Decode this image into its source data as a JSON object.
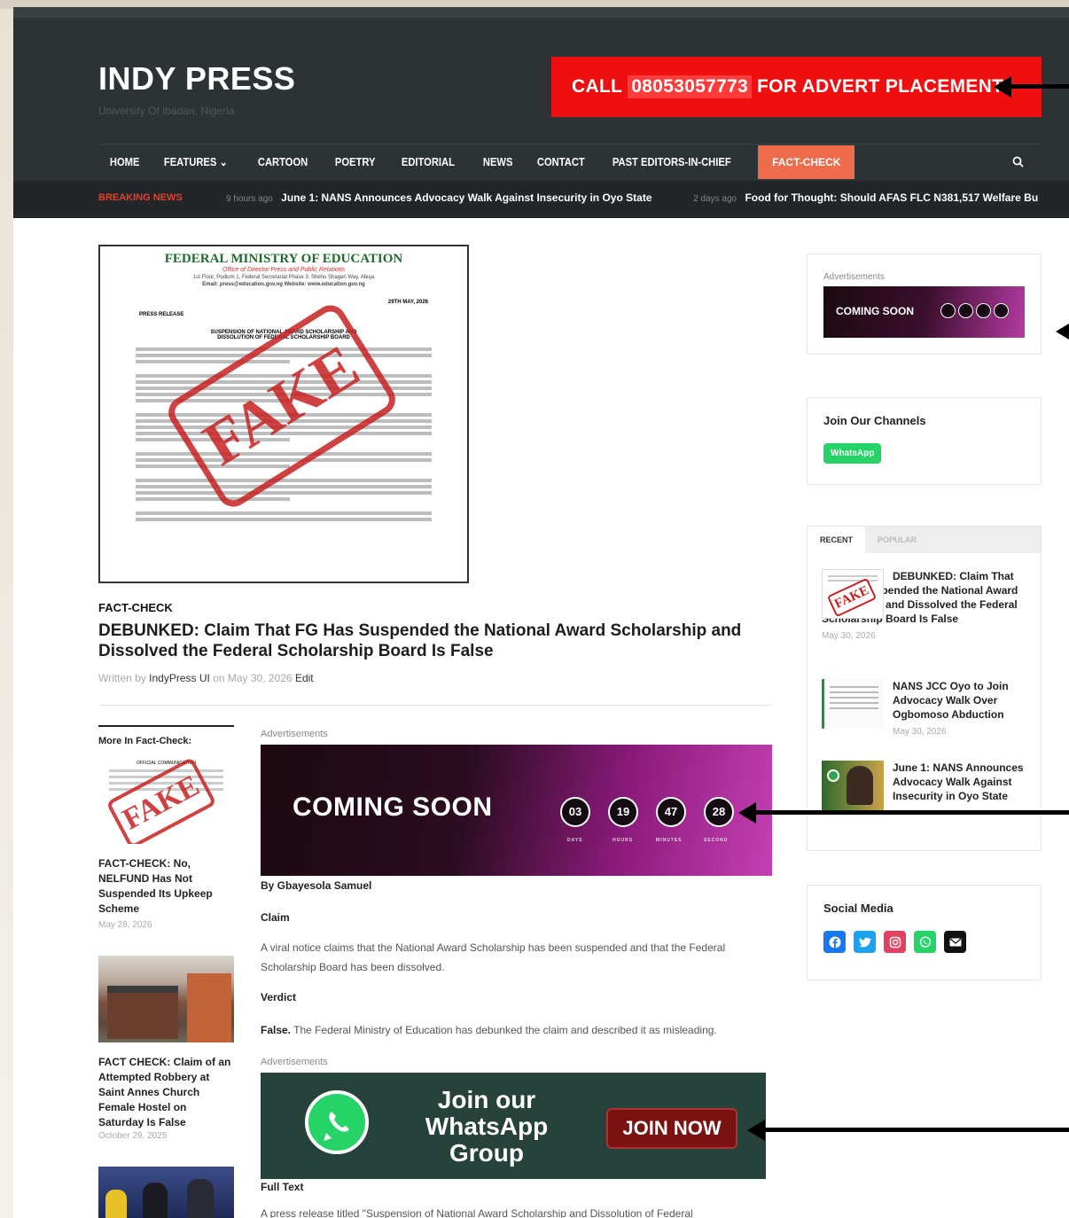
{
  "site": {
    "logo": "INDY PRESS",
    "tagline": "University Of Ibadan, Nigeria"
  },
  "advert": {
    "prefix": "CALL",
    "phone": "08053057773",
    "suffix": "FOR ADVERT PLACEMENT"
  },
  "nav": {
    "items": [
      "HOME",
      "FEATURES",
      "CARTOON",
      "POETRY",
      "EDITORIAL",
      "NEWS",
      "CONTACT",
      "PAST EDITORS-IN-CHIEF",
      "FACT-CHECK"
    ],
    "dropdown_marker": "⌄"
  },
  "breaking": {
    "label": "BREAKING NEWS",
    "items": [
      {
        "ago": "9 hours ago",
        "title": "June 1: NANS Announces Advocacy Walk Against Insecurity in Oyo State"
      },
      {
        "ago": "2 days ago",
        "title": "Food for Thought: Should AFAS FLC N381,517 Welfare Bu"
      }
    ]
  },
  "document": {
    "heading": "FEDERAL MINISTRY OF EDUCATION",
    "subheading": "Office of Director Press and Public Relations",
    "address": "1st Floor, Podium 1, Federal Secretariat Phase 3, Shehu Shagari Way, Abuja",
    "contact": "Email: press@education.gov.ng   Website: www.education.gov.ng",
    "date": "29TH MAY, 2026",
    "label": "PRESS RELEASE",
    "title_1": "SUSPENSION OF NATIONAL AWARD SCHOLARSHIP AND",
    "title_2": "DISSOLUTION OF FEDERAL SCHOLARSHIP BOARD",
    "stamp": "FAKE"
  },
  "article": {
    "category": "FACT-CHECK",
    "title": "DEBUNKED: Claim That FG Has Suspended the National Award Scholarship and Dissolved the Federal Scholarship Board Is False",
    "written_by": "Written by",
    "author": "IndyPress UI",
    "on": "on",
    "date": "May 30, 2026",
    "edit": "Edit",
    "ads_label": "Advertisements",
    "by": "By Gbayesola Samuel",
    "claim_heading": "Claim",
    "claim_text": "A viral notice claims that the National Award Scholarship has been suspended and that the Federal Scholarship Board has been dissolved.",
    "verdict_heading": "Verdict",
    "verdict_lead": "False.",
    "verdict_text": "The Federal Ministry of Education has debunked the claim and described it as misleading.",
    "full_text_heading": "Full Text",
    "full_text_start": "A press release titled \"Suspension of National Award Scholarship and Dissolution of Federal"
  },
  "countdown": {
    "headline": "COMING SOON",
    "values": [
      "03",
      "19",
      "47",
      "28"
    ],
    "labels": [
      "DAYS",
      "HOURS",
      "MINUTES",
      "SECOND"
    ]
  },
  "whatsapp_ad": {
    "line1": "Join our",
    "line2": "WhatsApp",
    "line3": "Group",
    "button": "JOIN NOW"
  },
  "more": {
    "heading": "More In Fact-Check:",
    "items": [
      {
        "title": "FACT-CHECK: No, NELFUND Has Not Suspended Its Upkeep Scheme",
        "date": "May 28, 2026",
        "thumb_text": "OFFICIAL COMMUNICATION"
      },
      {
        "title": "FACT CHECK: Claim of an Attempted Robbery at Saint Annes Church Female Hostel on Saturday Is False",
        "date": "October 29, 2025"
      }
    ]
  },
  "sidebar": {
    "ads_label": "Advertisements",
    "ad_headline": "COMING SOON",
    "channels_title": "Join Our Channels",
    "whatsapp_button": "WhatsApp",
    "tabs": [
      "RECENT",
      "POPULAR"
    ],
    "recent": [
      {
        "title": "DEBUNKED: Claim That FG Has Suspended the National Award Scholarship and Dissolved the Federal Scholarship Board Is False",
        "date": "May 30, 2026"
      },
      {
        "title": "NANS JCC Oyo to Join Advocacy Walk Over Ogbomoso Abduction",
        "date": "May 30, 2026"
      },
      {
        "title": "June 1: NANS Announces Advocacy Walk Against Insecurity in Oyo State",
        "date": ""
      }
    ],
    "social_title": "Social Media",
    "social_icons": [
      "facebook-icon",
      "twitter-icon",
      "instagram-icon",
      "whatsapp-icon",
      "email-icon"
    ]
  },
  "colors": {
    "header_bg": "#2d3234",
    "advert_red": "#ee1010",
    "active_tab": "#ee6b4b",
    "breaking_red": "#e0412c",
    "whatsapp_green": "#25d366"
  }
}
